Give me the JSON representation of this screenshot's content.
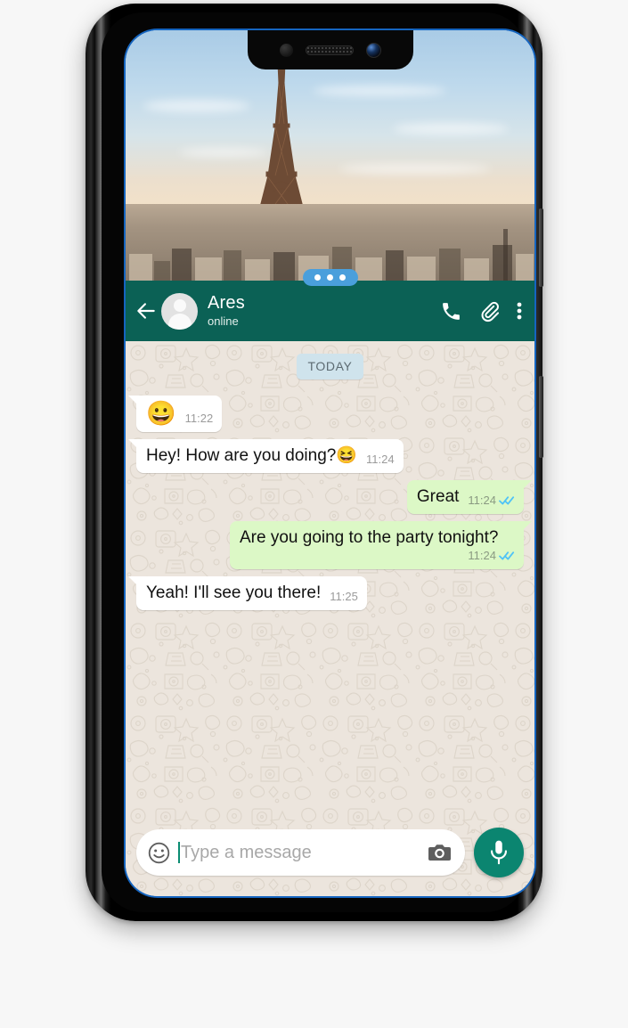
{
  "device": {
    "notch": {
      "sensor": "proximity-sensor",
      "speaker": "earpiece-speaker",
      "camera": "front-camera"
    },
    "buttons": {
      "volume": "volume-rocker",
      "power": "power-button"
    }
  },
  "wallpaper": {
    "scene": "Eiffel Tower Paris skyline at sunset",
    "carousel": {
      "dots": 3,
      "pill_color": "#4a9fdc"
    }
  },
  "header": {
    "back_icon": "back-arrow-icon",
    "avatar": "default-contact-avatar",
    "contact_name": "Ares",
    "status": "online",
    "actions": [
      {
        "name": "call-button",
        "icon": "phone-icon"
      },
      {
        "name": "attach-button",
        "icon": "paperclip-icon"
      },
      {
        "name": "more-menu-button",
        "icon": "overflow-menu-icon"
      }
    ],
    "background_color": "#0b6155"
  },
  "chat": {
    "date_divider": "TODAY",
    "background_color": "#ece5dd",
    "incoming_bubble_color": "#ffffff",
    "outgoing_bubble_color": "#dcf8c6",
    "read_tick_color": "#4fc3f7",
    "messages": [
      {
        "id": "msg-1",
        "direction": "incoming",
        "text": "😀",
        "emoji_only": true,
        "time": "11:22",
        "status": ""
      },
      {
        "id": "msg-2",
        "direction": "incoming",
        "text": "Hey! How are you doing?😆",
        "emoji_only": false,
        "time": "11:24",
        "status": ""
      },
      {
        "id": "msg-3",
        "direction": "outgoing",
        "text": "Great",
        "emoji_only": false,
        "time": "11:24",
        "status": "read"
      },
      {
        "id": "msg-4",
        "direction": "outgoing",
        "text": "Are you going to the party tonight?",
        "emoji_only": false,
        "time": "11:24",
        "status": "read",
        "meta_on_own_line": true
      },
      {
        "id": "msg-5",
        "direction": "incoming",
        "text": "Yeah! I'll see you there!",
        "emoji_only": false,
        "time": "11:25",
        "status": ""
      }
    ]
  },
  "composer": {
    "emoji_icon": "smiley-icon",
    "placeholder": "Type a message",
    "value": "",
    "camera_icon": "camera-icon",
    "mic_icon": "microphone-icon",
    "mic_button_color": "#0b8570",
    "cursor_color": "#0b8c72"
  }
}
